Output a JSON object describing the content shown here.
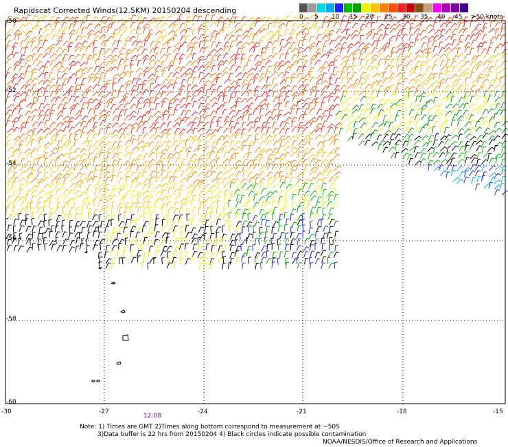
{
  "title": "Rapidscat Corrected Winds(12.5KM) 20150204 descending",
  "legend": {
    "colors": [
      "#555555",
      "#9a9a9a",
      "#00d8e8",
      "#00aaff",
      "#2222ff",
      "#00c000",
      "#00a000",
      "#f0f000",
      "#ffc000",
      "#ff8000",
      "#ff5000",
      "#ff2020",
      "#cc0000",
      "#8a4a10",
      "#c8a080",
      "#ff00ff",
      "#b000c0",
      "#8000b0",
      "#400090"
    ],
    "labels": [
      "0",
      "5",
      "10",
      "15",
      "20",
      "25",
      "30",
      "35",
      "40",
      "45",
      ">50 knots"
    ]
  },
  "map": {
    "lat_labels": [
      "-50",
      "-52",
      "-54",
      "-56",
      "-58",
      "-60"
    ],
    "lon_labels": [
      "-30",
      "-27",
      "-24",
      "-21",
      "-18",
      "-15"
    ],
    "time_label": "12:08"
  },
  "notes": {
    "line1": "Note: 1) Times are GMT 2)Times along bottom correspond to measurement at ~50S",
    "line2": "3)Data buffer is 22 hrs from 20150204 4) Black circles indicate possible contamination",
    "line3": "NOAA/NESDIS/Office of Research and Applications"
  }
}
